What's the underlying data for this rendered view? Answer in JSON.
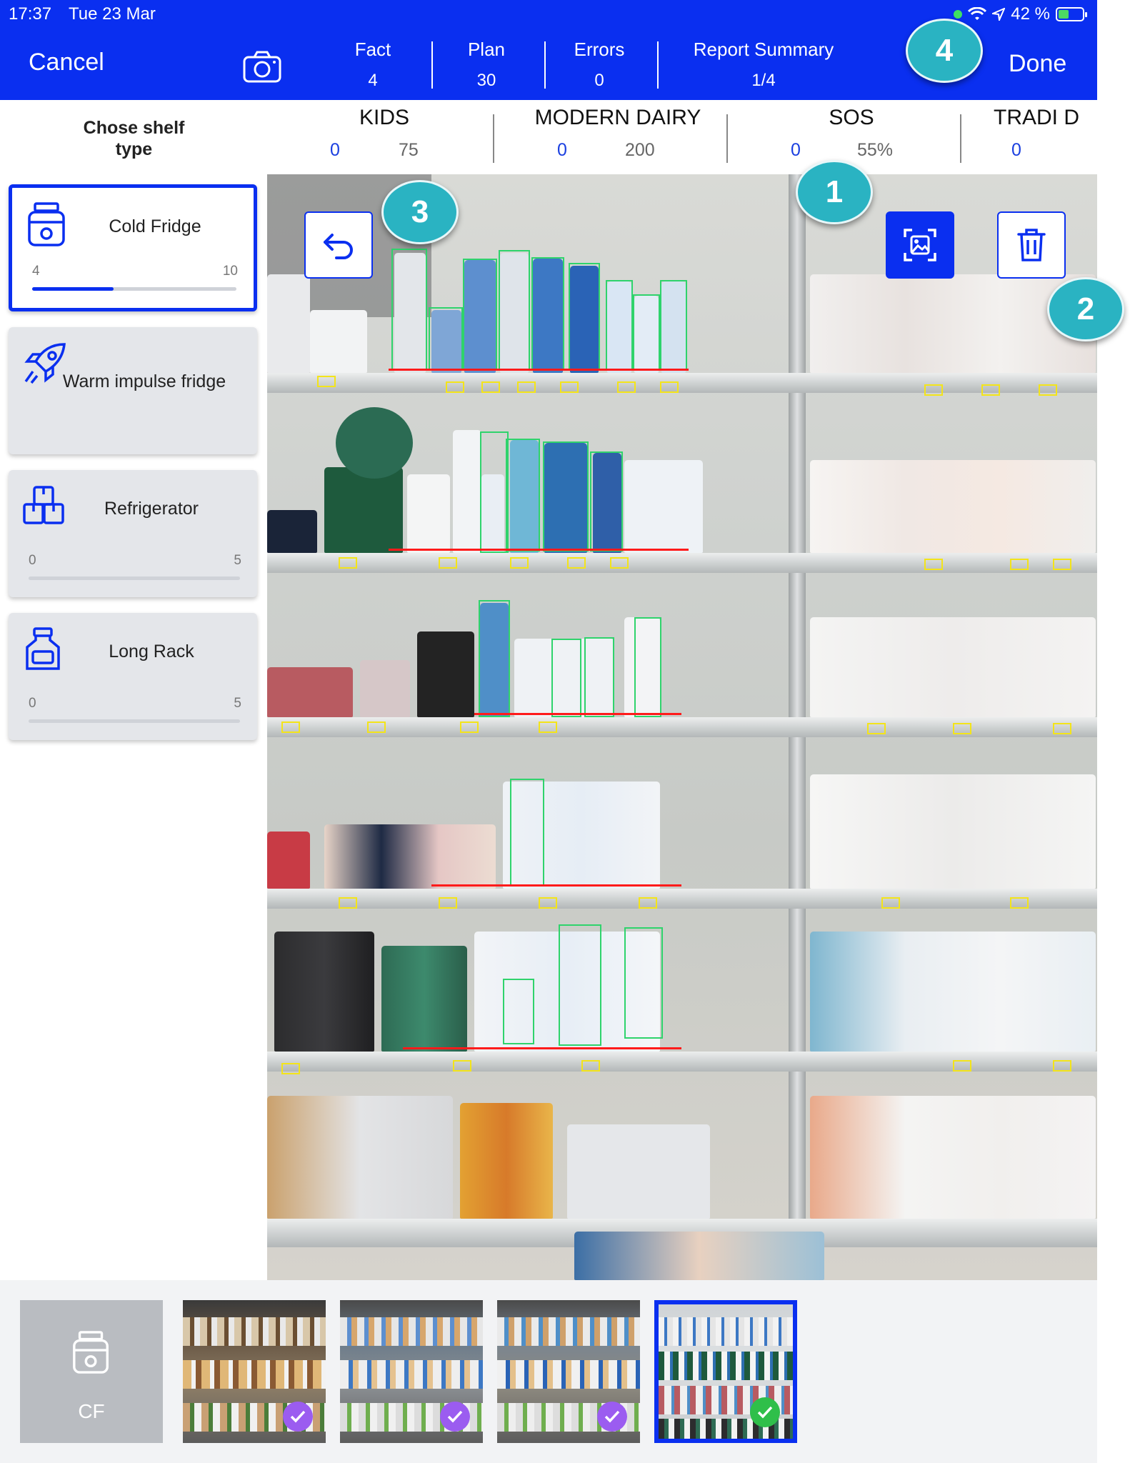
{
  "status_bar": {
    "time": "17:37",
    "date": "Tue 23 Mar",
    "battery": "42 %"
  },
  "toolbar": {
    "cancel_label": "Cancel",
    "done_label": "Done",
    "metrics": [
      {
        "label": "Fact",
        "value": "4"
      },
      {
        "label": "Plan",
        "value": "30"
      },
      {
        "label": "Errors",
        "value": "0"
      },
      {
        "label": "Report Summary",
        "value": "1/4"
      }
    ]
  },
  "shelf_type_heading": "Chose shelf type",
  "categories": [
    {
      "name": "KIDS",
      "left": "0",
      "right": "75"
    },
    {
      "name": "MODERN DAIRY",
      "left": "0",
      "right": "200"
    },
    {
      "name": "SOS",
      "left": "0",
      "right": "55%"
    },
    {
      "name": "TRADI D",
      "left": "0",
      "right": ""
    }
  ],
  "shelf_types": [
    {
      "label": "Cold Fridge",
      "min": "4",
      "max": "10",
      "progress": 0.4,
      "icon": "jar-icon",
      "active": true
    },
    {
      "label": "Warm impulse fridge",
      "min": "",
      "max": "",
      "progress": 0,
      "icon": "rocket-icon",
      "active": false
    },
    {
      "label": "Refrigerator",
      "min": "0",
      "max": "5",
      "progress": 0,
      "icon": "boxes-icon",
      "active": false
    },
    {
      "label": "Long Rack",
      "min": "0",
      "max": "5",
      "progress": 0,
      "icon": "bottle-icon",
      "active": false
    }
  ],
  "callouts": [
    "1",
    "2",
    "3",
    "4"
  ],
  "photo_tools": {
    "crop": "crop-image-icon",
    "delete": "trash-icon",
    "undo": "undo-icon"
  },
  "thumbnails": {
    "cf_label": "CF",
    "items": [
      {
        "check": "purple",
        "selected": false
      },
      {
        "check": "purple",
        "selected": false
      },
      {
        "check": "purple",
        "selected": false
      },
      {
        "check": "green",
        "selected": true
      }
    ]
  },
  "colors": {
    "brand_blue": "#0a2ff0",
    "callout_teal": "#2ab3c2",
    "check_purple": "#9b5cf0",
    "check_green": "#2fbf4a"
  }
}
